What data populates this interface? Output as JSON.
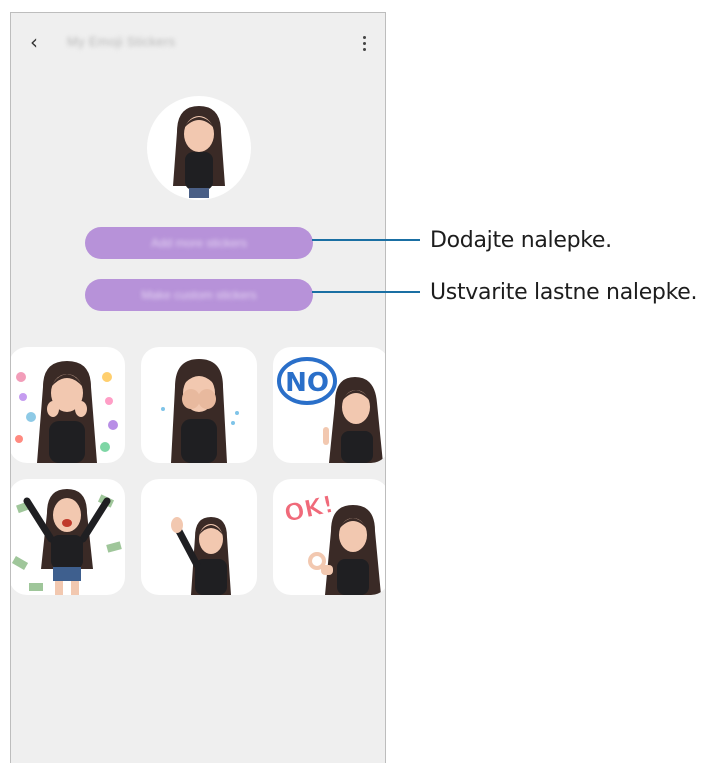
{
  "header": {
    "title": "My Emoji Stickers",
    "back_icon": "chevron-left-icon",
    "more_icon": "more-vertical-icon"
  },
  "buttons": {
    "add": "Add more stickers",
    "make": "Make custom stickers"
  },
  "sticker_text": {
    "no": "NO",
    "ok": "OK!"
  },
  "annotations": {
    "add": "Dodajte nalepke.",
    "make": "Ustvarite lastne nalepke."
  },
  "colors": {
    "accent": "#b792d9",
    "background": "#efefef",
    "callout_line": "#1a6fa3"
  }
}
